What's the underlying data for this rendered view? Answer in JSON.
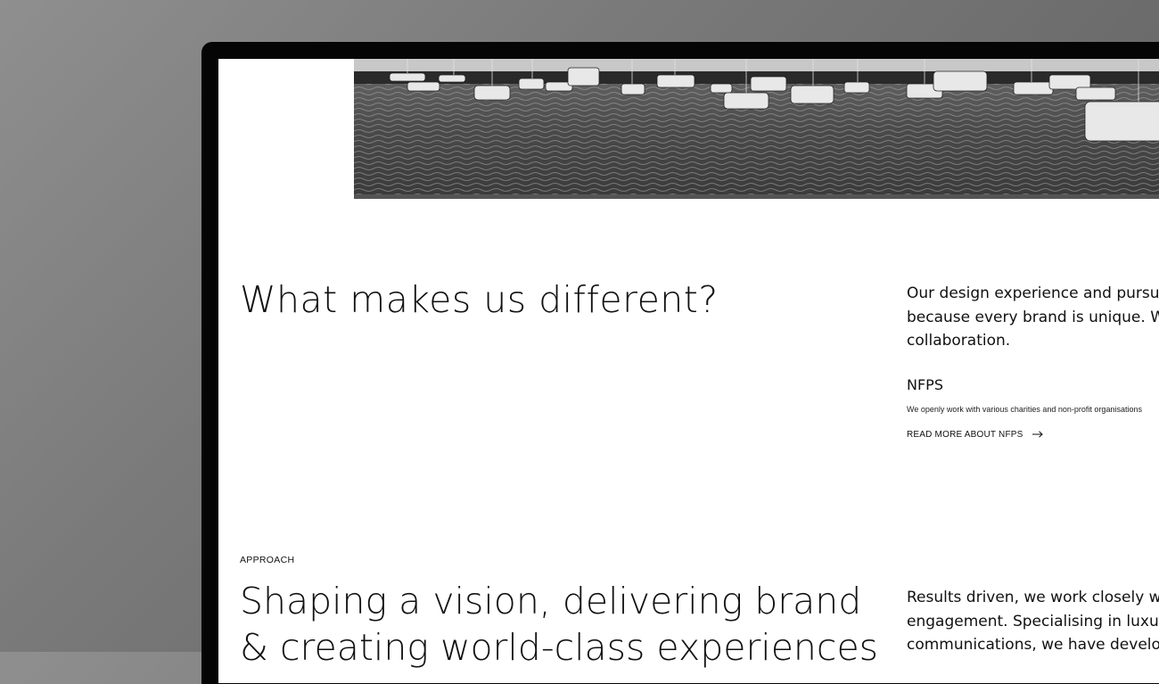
{
  "hero": {
    "alt": "Boats moored on the water"
  },
  "different": {
    "heading": "What makes us different?",
    "lead_lines": [
      "Our design experience and pursuit for",
      "because every brand is unique. We're",
      "collaboration."
    ],
    "nfps": {
      "title": "NFPS",
      "description": "We openly work with various charities and non-profit organisations",
      "link": "READ MORE ABOUT NFPS"
    }
  },
  "approach": {
    "eyebrow": "APPROACH",
    "heading_lines": [
      "Shaping a vision, delivering brand",
      "& creating world-class experiences"
    ],
    "body_lines": [
      "Results driven, we work closely with o",
      "engagement. Specialising in luxury bra",
      "communications, we have developed r"
    ]
  },
  "colors": {
    "background": "#ffffff",
    "text": "#111111",
    "bezel": "#050505"
  }
}
